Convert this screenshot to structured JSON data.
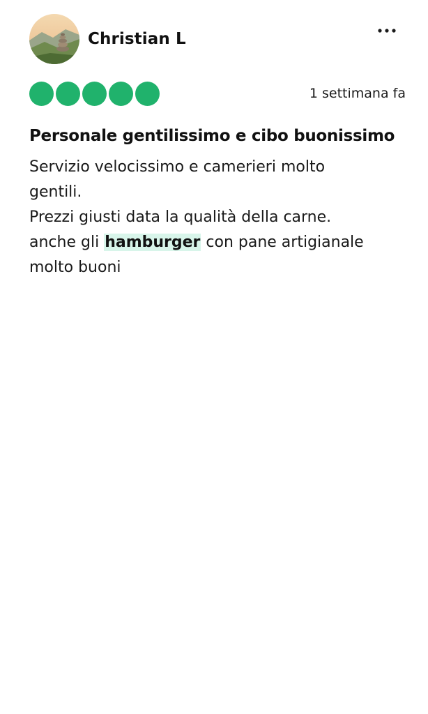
{
  "review": {
    "author": "Christian L",
    "rating": 5,
    "rating_max": 5,
    "date": "1 settimana fa",
    "title": "Personale gentilissimo e cibo buonissimo",
    "body": {
      "line1": "Servizio velocissimo e camerieri molto",
      "line2": "gentili.",
      "line3": "Prezzi giusti data la qualità della carne.",
      "line4_before": "anche gli ",
      "highlight": "hamburger",
      "line4_after": " con pane artigianale",
      "line5": "molto buoni"
    }
  },
  "icons": {
    "more": "more-options-icon",
    "avatar": "avatar"
  },
  "colors": {
    "bubble": "#20b26c",
    "highlight": "#d8f5ea"
  }
}
